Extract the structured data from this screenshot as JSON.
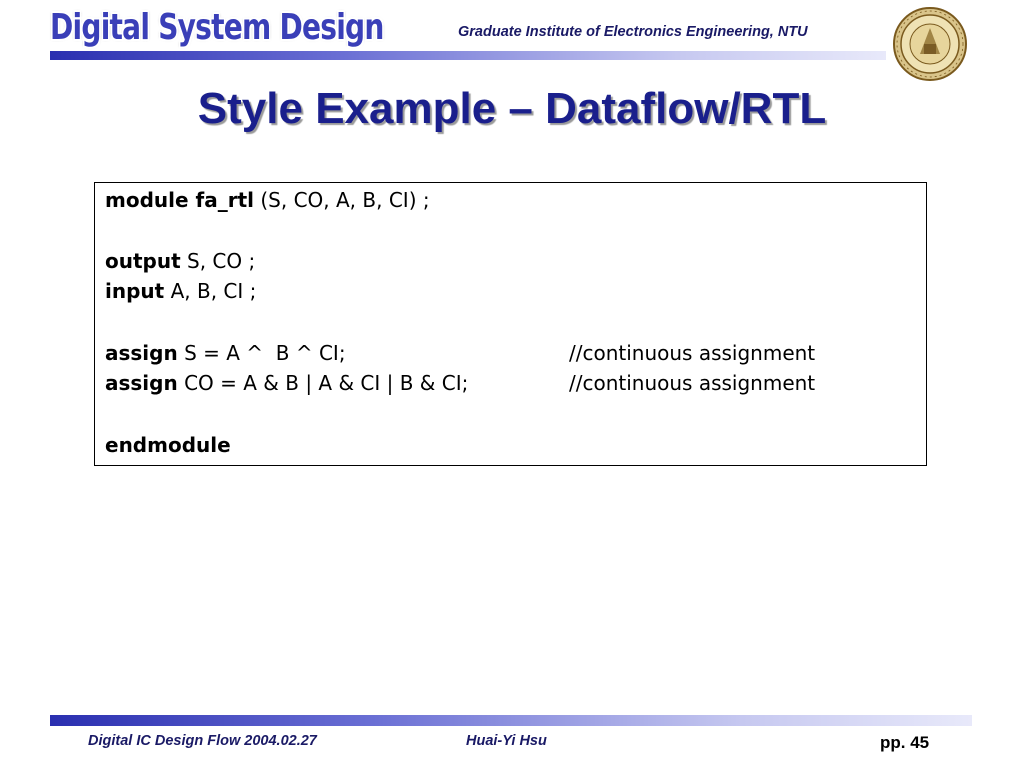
{
  "header": {
    "logo_text": "Digital System Design",
    "institute": "Graduate Institute of Electronics Engineering, NTU"
  },
  "slide": {
    "title": "Style Example – Dataflow/RTL"
  },
  "code": {
    "l1_kw": "module fa_rtl",
    "l1_rest": " (S, CO, A, B, CI) ;",
    "l2_kw": "output",
    "l2_rest": " S, CO ;",
    "l3_kw": "input",
    "l3_rest": " A, B, CI ;",
    "l4_kw": "assign",
    "l4_rest": " S = A ^  B ^ CI;",
    "l4_comment": "//continuous assignment",
    "l5_kw": "assign",
    "l5_rest": " CO = A & B | A & CI | B & CI;",
    "l5_comment": "//continuous assignment",
    "l6_kw": "endmodule"
  },
  "footer": {
    "course": "Digital IC Design Flow 2004.02.27",
    "author": "Huai-Yi Hsu",
    "page": "pp. 45"
  },
  "colors": {
    "title": "#1a1f8c",
    "bar_start": "#2a2fb0",
    "bar_end": "#e8e9fa",
    "seal": "#7a5a1e"
  }
}
